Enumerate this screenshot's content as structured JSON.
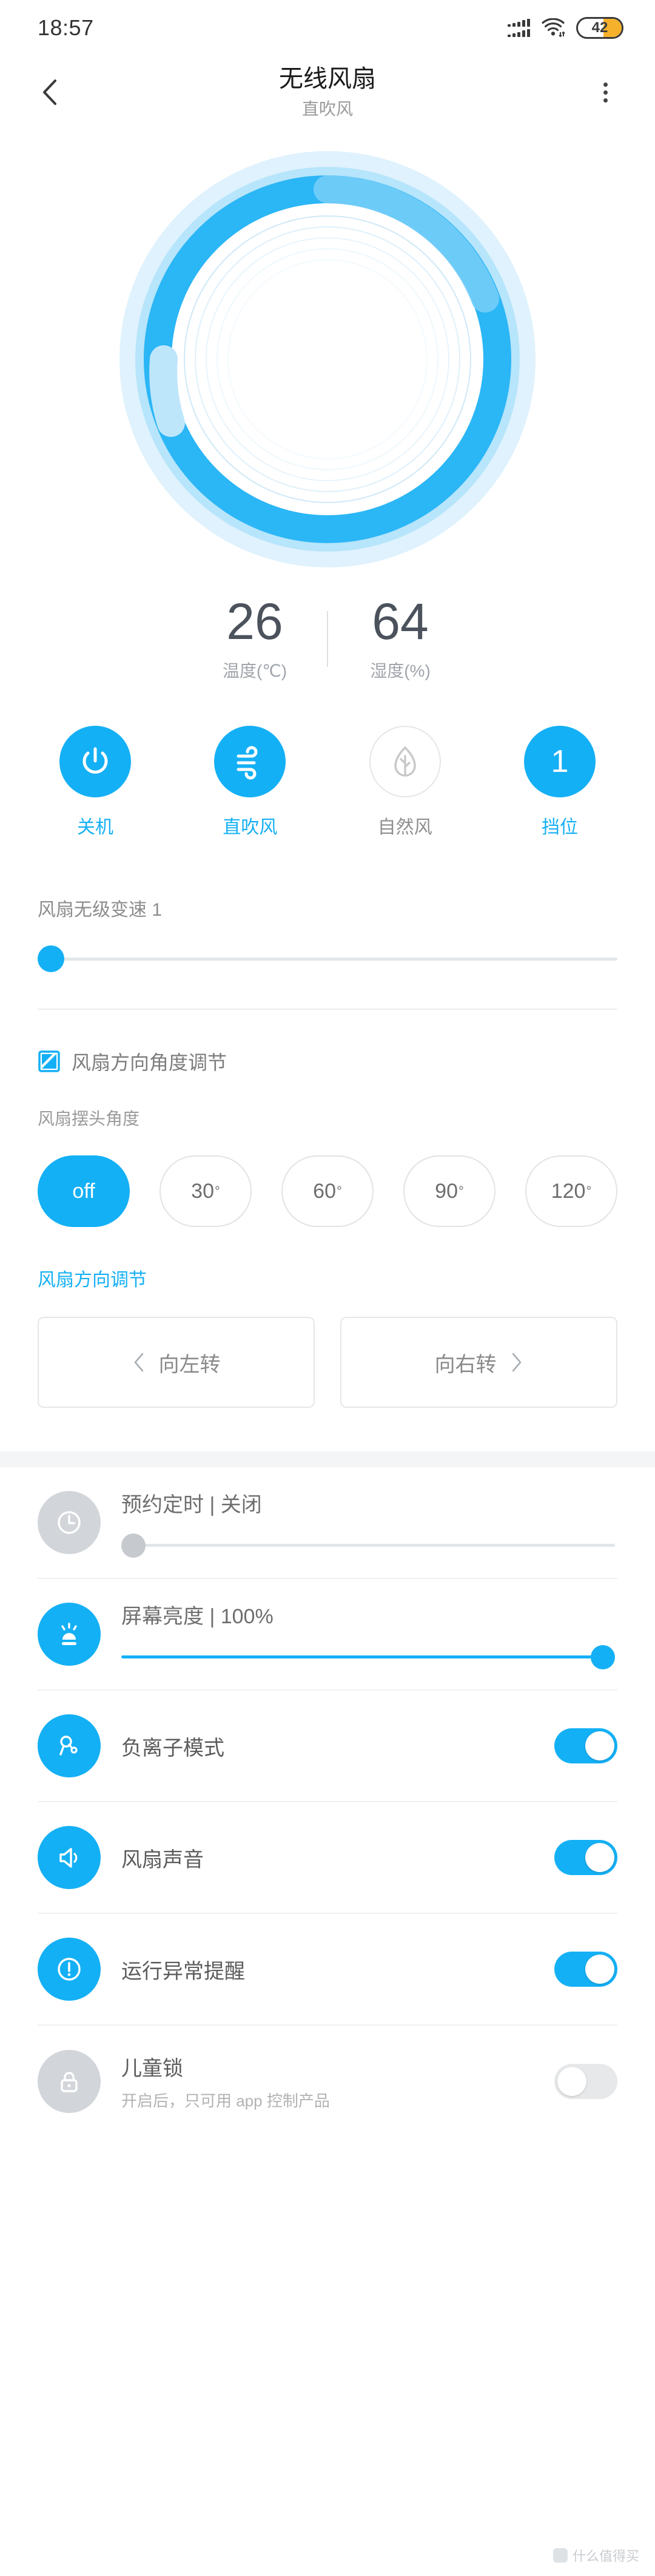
{
  "status_bar": {
    "time": "18:57",
    "battery_percent": "42",
    "icons": [
      "signal-bars-icon",
      "wifi-icon",
      "battery-icon"
    ]
  },
  "header": {
    "back_icon": "chevron-left-icon",
    "title": "无线风扇",
    "subtitle": "直吹风",
    "menu_icon": "more-vertical-icon"
  },
  "dial": {
    "name": "fan-dial-graphic",
    "accent": "#14b0f5"
  },
  "readings": {
    "temperature": {
      "value": "26",
      "label": "温度(℃)"
    },
    "humidity": {
      "value": "64",
      "label": "湿度(%)"
    }
  },
  "modes": [
    {
      "label": "关机",
      "icon": "power-icon",
      "active": true
    },
    {
      "label": "直吹风",
      "icon": "wind-icon",
      "active": true
    },
    {
      "label": "自然风",
      "icon": "leaf-icon",
      "active": false
    },
    {
      "label": "挡位",
      "icon": "gear-level-1",
      "value": "1",
      "active": true
    }
  ],
  "speed": {
    "label": "风扇无级变速 1",
    "value": 1,
    "min": 1,
    "max": 100,
    "percent": 1
  },
  "angle_section": {
    "header_icon": "angle-adjust-icon",
    "header": "风扇方向角度调节",
    "sub_label": "风扇摆头角度",
    "options": [
      {
        "label": "off",
        "selected": true
      },
      {
        "label": "30",
        "degree": "°",
        "selected": false
      },
      {
        "label": "60",
        "degree": "°",
        "selected": false
      },
      {
        "label": "90",
        "degree": "°",
        "selected": false
      },
      {
        "label": "120",
        "degree": "°",
        "selected": false
      }
    ],
    "direction_title": "风扇方向调节",
    "direction_buttons": [
      {
        "label": "向左转",
        "icon": "chevron-left-icon",
        "icon_side": "left"
      },
      {
        "label": "向右转",
        "icon": "chevron-right-icon",
        "icon_side": "right"
      }
    ]
  },
  "settings": [
    {
      "name": "timer",
      "icon": "clock-icon",
      "icon_state": "gray",
      "label": "预约定时 | 关闭",
      "control": "slider",
      "slider_percent": 0,
      "slider_filled": false
    },
    {
      "name": "screen-brightness",
      "icon": "brightness-icon",
      "icon_state": "blue",
      "label": "屏幕亮度 | 100%",
      "control": "slider",
      "slider_percent": 100,
      "slider_filled": true
    },
    {
      "name": "anion-mode",
      "icon": "anion-icon",
      "icon_state": "blue",
      "label": "负离子模式",
      "control": "toggle",
      "toggle_on": true
    },
    {
      "name": "fan-sound",
      "icon": "speaker-icon",
      "icon_state": "blue",
      "label": "风扇声音",
      "control": "toggle",
      "toggle_on": true
    },
    {
      "name": "abnormal-alert",
      "icon": "alert-icon",
      "icon_state": "blue",
      "label": "运行异常提醒",
      "control": "toggle",
      "toggle_on": true
    },
    {
      "name": "child-lock",
      "icon": "lock-icon",
      "icon_state": "gray",
      "label": "儿童锁",
      "sub": "开启后，只可用 app 控制产品",
      "control": "toggle",
      "toggle_on": false
    }
  ],
  "watermark": {
    "text": "什么值得买"
  }
}
